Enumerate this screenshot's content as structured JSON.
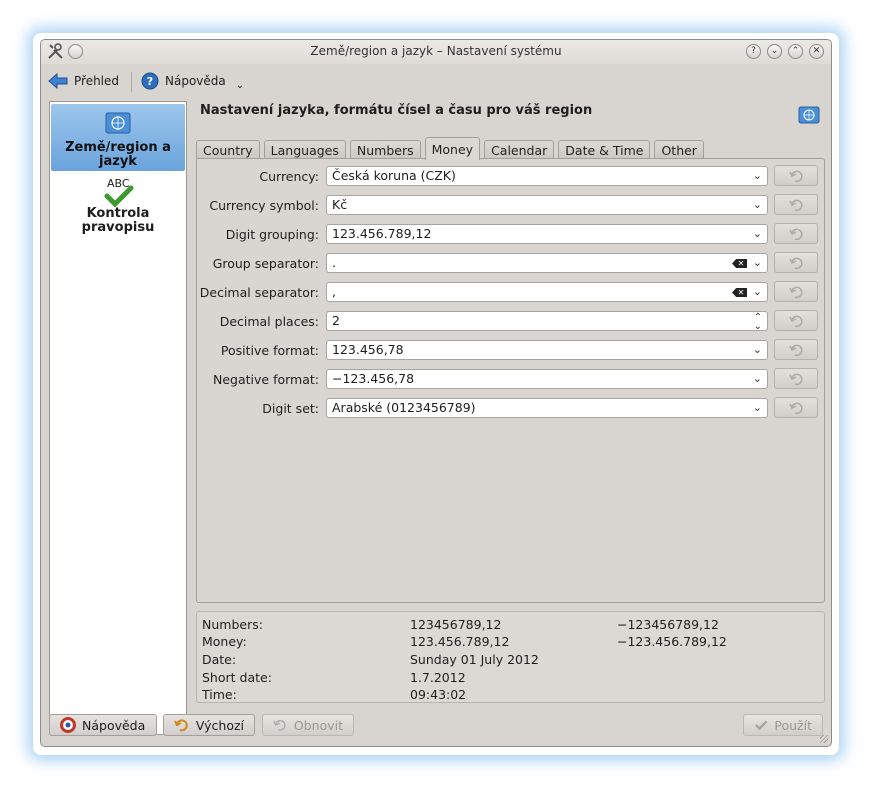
{
  "window": {
    "title": "Země/region a jazyk – Nastavení systému",
    "help_glyph": "?",
    "minimize_glyph": "⌄",
    "maximize_glyph": "⌃",
    "close_glyph": "✕"
  },
  "toolbar": {
    "overview_label": "Přehled",
    "help_label": "Nápověda"
  },
  "sidebar": {
    "items": [
      {
        "label": "Země/region a jazyk",
        "icon": "un-flag-icon",
        "selected": true
      },
      {
        "label": "Kontrola pravopisu",
        "icon": "spellcheck-icon",
        "icon_text": "ABC",
        "selected": false
      }
    ]
  },
  "header": {
    "title": "Nastavení jazyka, formátu čísel a času pro váš region"
  },
  "tabs": [
    {
      "label": "Country",
      "active": false
    },
    {
      "label": "Languages",
      "active": false
    },
    {
      "label": "Numbers",
      "active": false
    },
    {
      "label": "Money",
      "active": true
    },
    {
      "label": "Calendar",
      "active": false
    },
    {
      "label": "Date & Time",
      "active": false
    },
    {
      "label": "Other",
      "active": false
    }
  ],
  "form": {
    "currency": {
      "label": "Currency:",
      "value": "Česká koruna (CZK)"
    },
    "currency_symbol": {
      "label": "Currency symbol:",
      "value": "Kč"
    },
    "digit_grouping": {
      "label": "Digit grouping:",
      "value": "123.456.789,12"
    },
    "group_separator": {
      "label": "Group separator:",
      "value": "."
    },
    "decimal_separator": {
      "label": "Decimal separator:",
      "value": ","
    },
    "decimal_places": {
      "label": "Decimal places:",
      "value": "2"
    },
    "positive_format": {
      "label": "Positive format:",
      "value": "123.456,78"
    },
    "negative_format": {
      "label": "Negative format:",
      "value": "−123.456,78"
    },
    "digit_set": {
      "label": "Digit set:",
      "value": "Arabské (0123456789)"
    }
  },
  "examples": {
    "numbers": {
      "label": "Numbers:",
      "positive": "123456789,12",
      "negative": "−123456789,12"
    },
    "money": {
      "label": "Money:",
      "positive": "123.456.789,12",
      "negative": "−123.456.789,12"
    },
    "date": {
      "label": "Date:",
      "value": "Sunday 01 July 2012"
    },
    "short_date": {
      "label": "Short date:",
      "value": "1.7.2012"
    },
    "time": {
      "label": "Time:",
      "value": "09:43:02"
    }
  },
  "buttons": {
    "help": "Nápověda",
    "defaults": "Výchozí",
    "reset": "Obnovit",
    "apply": "Použít"
  },
  "colors": {
    "selection": "#7fb2e3",
    "window_bg": "#d8d5d1",
    "glow": "#6eb4eb",
    "un_flag": "#4b8fd8"
  }
}
